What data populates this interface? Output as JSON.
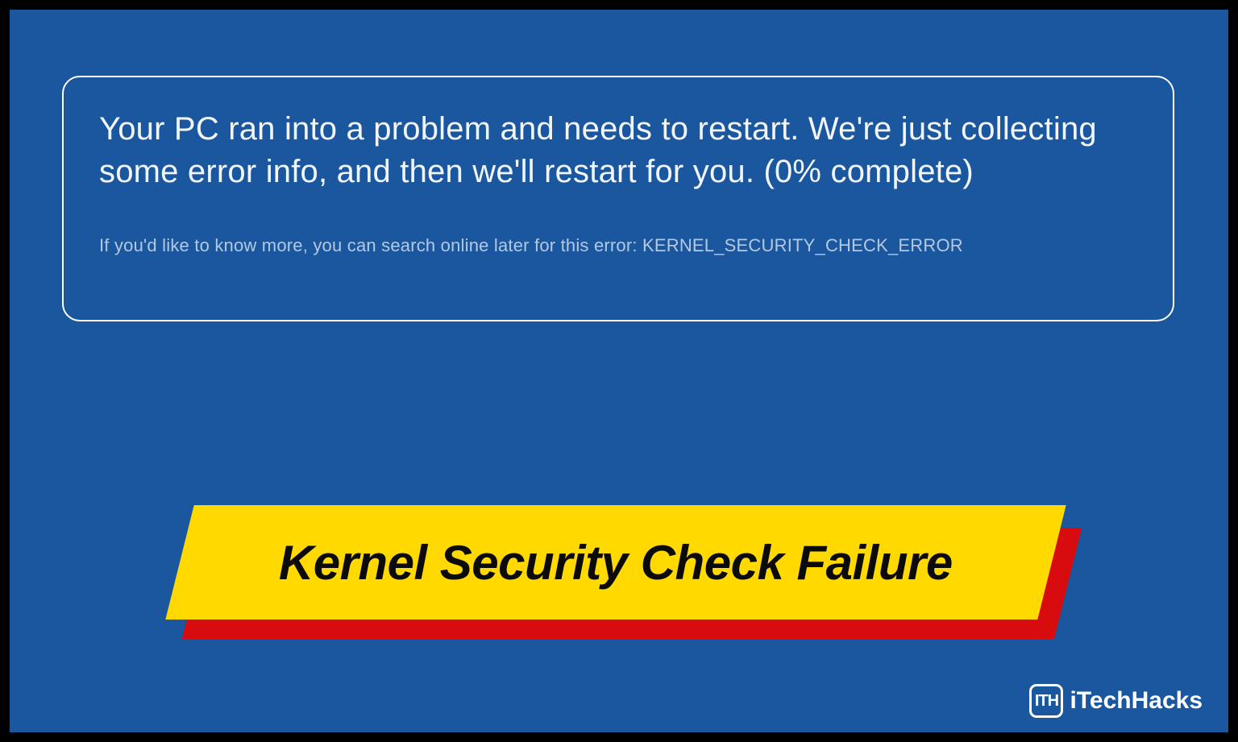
{
  "bsod": {
    "message": "Your PC ran into a problem and needs to restart. We're just collecting some error info, and then we'll restart for you. (0% complete)",
    "detail": "If you'd like to know more, you can search online later for this error: KERNEL_SECURITY_CHECK_ERROR"
  },
  "banner": {
    "title": "Kernel Security Check Failure"
  },
  "watermark": {
    "logo_text": "ITH",
    "brand": "iTechHacks"
  },
  "colors": {
    "background": "#1a579e",
    "border": "#000000",
    "banner_front": "#ffd900",
    "banner_shadow": "#d80b0f",
    "text_light": "#ffffff"
  }
}
